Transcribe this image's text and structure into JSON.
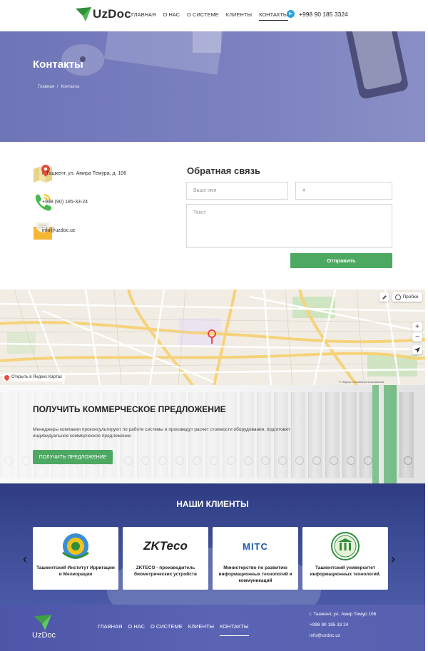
{
  "header": {
    "logo_text": "UzDoc",
    "nav": [
      "ГЛАВНАЯ",
      "О НАС",
      "О СИСТЕМЕ",
      "КЛИЕНТЫ",
      "КОНТАКТЫ"
    ],
    "active_nav": "КОНТАКТЫ",
    "phone": "+998 90 185 3324"
  },
  "hero": {
    "title": "Контакты",
    "breadcrumb_home": "Главная",
    "breadcrumb_sep": "/",
    "breadcrumb_current": "Контакты"
  },
  "contacts": {
    "address": "г. Ташкент, ул. Амира Темура, д. 106",
    "phone": "+998 (90) 185-33-24",
    "email": "info@uzdoc.uz"
  },
  "feedback": {
    "title": "Обратная связь",
    "name_placeholder": "Ваше имя",
    "phone_value": "+",
    "text_placeholder": "Текст",
    "submit_label": "Отправить"
  },
  "map": {
    "traffic_label": "Пробки",
    "open_label": "Открыть в Яндекс Картах",
    "copyright": "© Яндекс   Условия использования",
    "zoom_in": "+",
    "zoom_out": "−"
  },
  "offer": {
    "title": "ПОЛУЧИТЬ КОММЕРЧЕСКОЕ ПРЕДЛОЖЕНИЕ",
    "description": "Менеджеры компании проконсультируют по работе системы и произведут расчет стоимости оборудования, подготовят индивидуальное коммерческое предложение",
    "button_label": "ПОЛУЧИТЬ ПРЕДЛОЖЕНИЕ"
  },
  "clients": {
    "title": "НАШИ КЛИЕНТЫ",
    "items": [
      {
        "name": "Ташкентский Институт Ирригации и Мелиорации"
      },
      {
        "name": "ZKTECO - производитель биометрических устройств",
        "logo_text": "ZKTeco"
      },
      {
        "name": "Министерство по развитию информационных технологий и коммуникаций",
        "logo_text": "MITC"
      },
      {
        "name": "Ташкентский университет информационных технологий."
      }
    ],
    "prev_arrow": "‹",
    "next_arrow": "›"
  },
  "footer": {
    "logo_text": "UzDoc",
    "nav": [
      "ГЛАВНАЯ",
      "О НАС",
      "О СИСТЕМЕ",
      "КЛИЕНТЫ",
      "КОНТАКТЫ"
    ],
    "address": "г. Ташкент, ул. Амир Темур 106",
    "phone": "+998 90 185 33 24",
    "email": "info@uzdoc.uz"
  },
  "colors": {
    "brand_green": "#4da862",
    "hero_purple": "#7c82c0",
    "clients_blue": "#3d4d96",
    "footer_blue": "#5860b0"
  }
}
